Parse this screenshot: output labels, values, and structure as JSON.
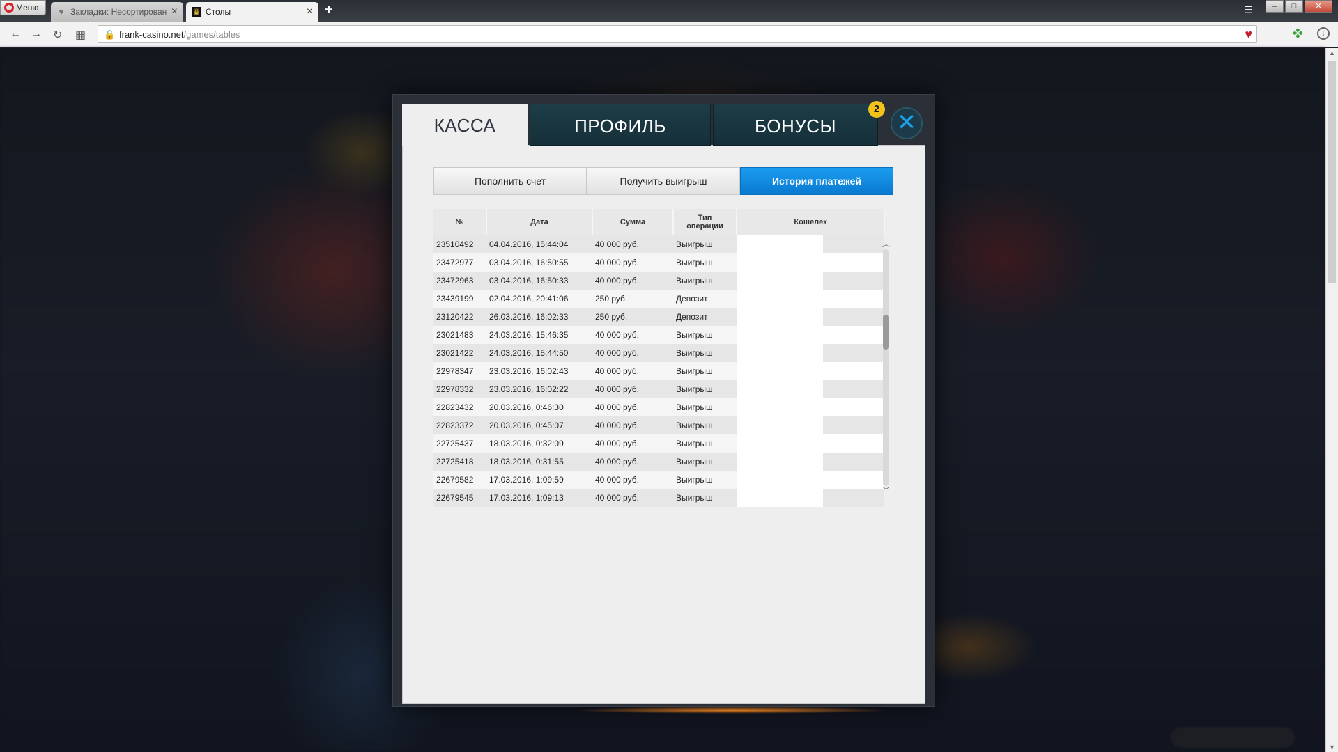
{
  "browser": {
    "menu_label": "Меню",
    "tabs": [
      {
        "title": "Закладки: Несортирован"
      },
      {
        "title": "Столы"
      }
    ],
    "new_tab": "+",
    "url_host": "frank-casino.net",
    "url_path": "/games/tables"
  },
  "modal": {
    "tabs": {
      "cashier": "КАССА",
      "profile": "ПРОФИЛЬ",
      "bonuses": "БОНУСЫ"
    },
    "bonus_badge": "2",
    "close_symbol": "✕",
    "segments": {
      "deposit": "Пополнить счет",
      "withdraw": "Получить выигрыш",
      "history": "История платежей"
    },
    "table": {
      "headers": {
        "num": "№",
        "date": "Дата",
        "sum": "Сумма",
        "type_line1": "Тип",
        "type_line2": "операции",
        "wallet": "Кошелек"
      },
      "rows": [
        {
          "num": "23510492",
          "date": "04.04.2016, 15:44:04",
          "sum": "40 000 руб.",
          "type": "Выигрыш"
        },
        {
          "num": "23472977",
          "date": "03.04.2016, 16:50:55",
          "sum": "40 000 руб.",
          "type": "Выигрыш"
        },
        {
          "num": "23472963",
          "date": "03.04.2016, 16:50:33",
          "sum": "40 000 руб.",
          "type": "Выигрыш"
        },
        {
          "num": "23439199",
          "date": "02.04.2016, 20:41:06",
          "sum": "250 руб.",
          "type": "Депозит"
        },
        {
          "num": "23120422",
          "date": "26.03.2016, 16:02:33",
          "sum": "250 руб.",
          "type": "Депозит"
        },
        {
          "num": "23021483",
          "date": "24.03.2016, 15:46:35",
          "sum": "40 000 руб.",
          "type": "Выигрыш"
        },
        {
          "num": "23021422",
          "date": "24.03.2016, 15:44:50",
          "sum": "40 000 руб.",
          "type": "Выигрыш"
        },
        {
          "num": "22978347",
          "date": "23.03.2016, 16:02:43",
          "sum": "40 000 руб.",
          "type": "Выигрыш"
        },
        {
          "num": "22978332",
          "date": "23.03.2016, 16:02:22",
          "sum": "40 000 руб.",
          "type": "Выигрыш"
        },
        {
          "num": "22823432",
          "date": "20.03.2016, 0:46:30",
          "sum": "40 000 руб.",
          "type": "Выигрыш"
        },
        {
          "num": "22823372",
          "date": "20.03.2016, 0:45:07",
          "sum": "40 000 руб.",
          "type": "Выигрыш"
        },
        {
          "num": "22725437",
          "date": "18.03.2016, 0:32:09",
          "sum": "40 000 руб.",
          "type": "Выигрыш"
        },
        {
          "num": "22725418",
          "date": "18.03.2016, 0:31:55",
          "sum": "40 000 руб.",
          "type": "Выигрыш"
        },
        {
          "num": "22679582",
          "date": "17.03.2016, 1:09:59",
          "sum": "40 000 руб.",
          "type": "Выигрыш"
        },
        {
          "num": "22679545",
          "date": "17.03.2016, 1:09:13",
          "sum": "40 000 руб.",
          "type": "Выигрыш"
        }
      ]
    }
  },
  "colors": {
    "accent_blue": "#1a9cf0",
    "tab_dark": "#1d3d46",
    "badge_yellow": "#f2c21a",
    "favorite_red": "#c21f2a"
  }
}
